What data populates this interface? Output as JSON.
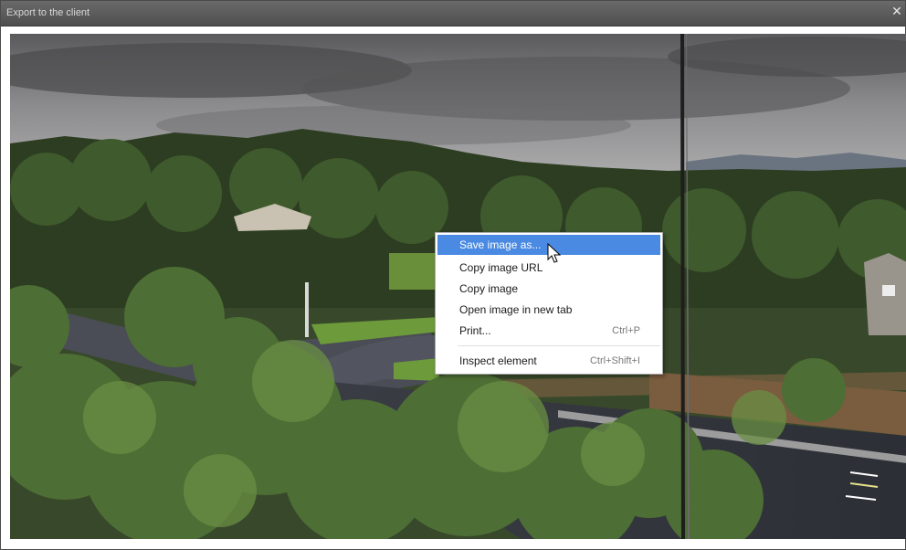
{
  "window": {
    "title": "Export to the client",
    "close_icon": "close-icon"
  },
  "context_menu": {
    "items": [
      {
        "label": "Save image as...",
        "shortcut": "",
        "highlighted": true
      },
      {
        "label": "Copy image URL",
        "shortcut": ""
      },
      {
        "label": "Copy image",
        "shortcut": ""
      },
      {
        "label": "Open image in new tab",
        "shortcut": ""
      },
      {
        "label": "Print...",
        "shortcut": "Ctrl+P"
      },
      {
        "label": "Inspect element",
        "shortcut": "Ctrl+Shift+I"
      }
    ]
  },
  "colors": {
    "highlight": "#4a8ae2",
    "titlebar": "#555555"
  }
}
